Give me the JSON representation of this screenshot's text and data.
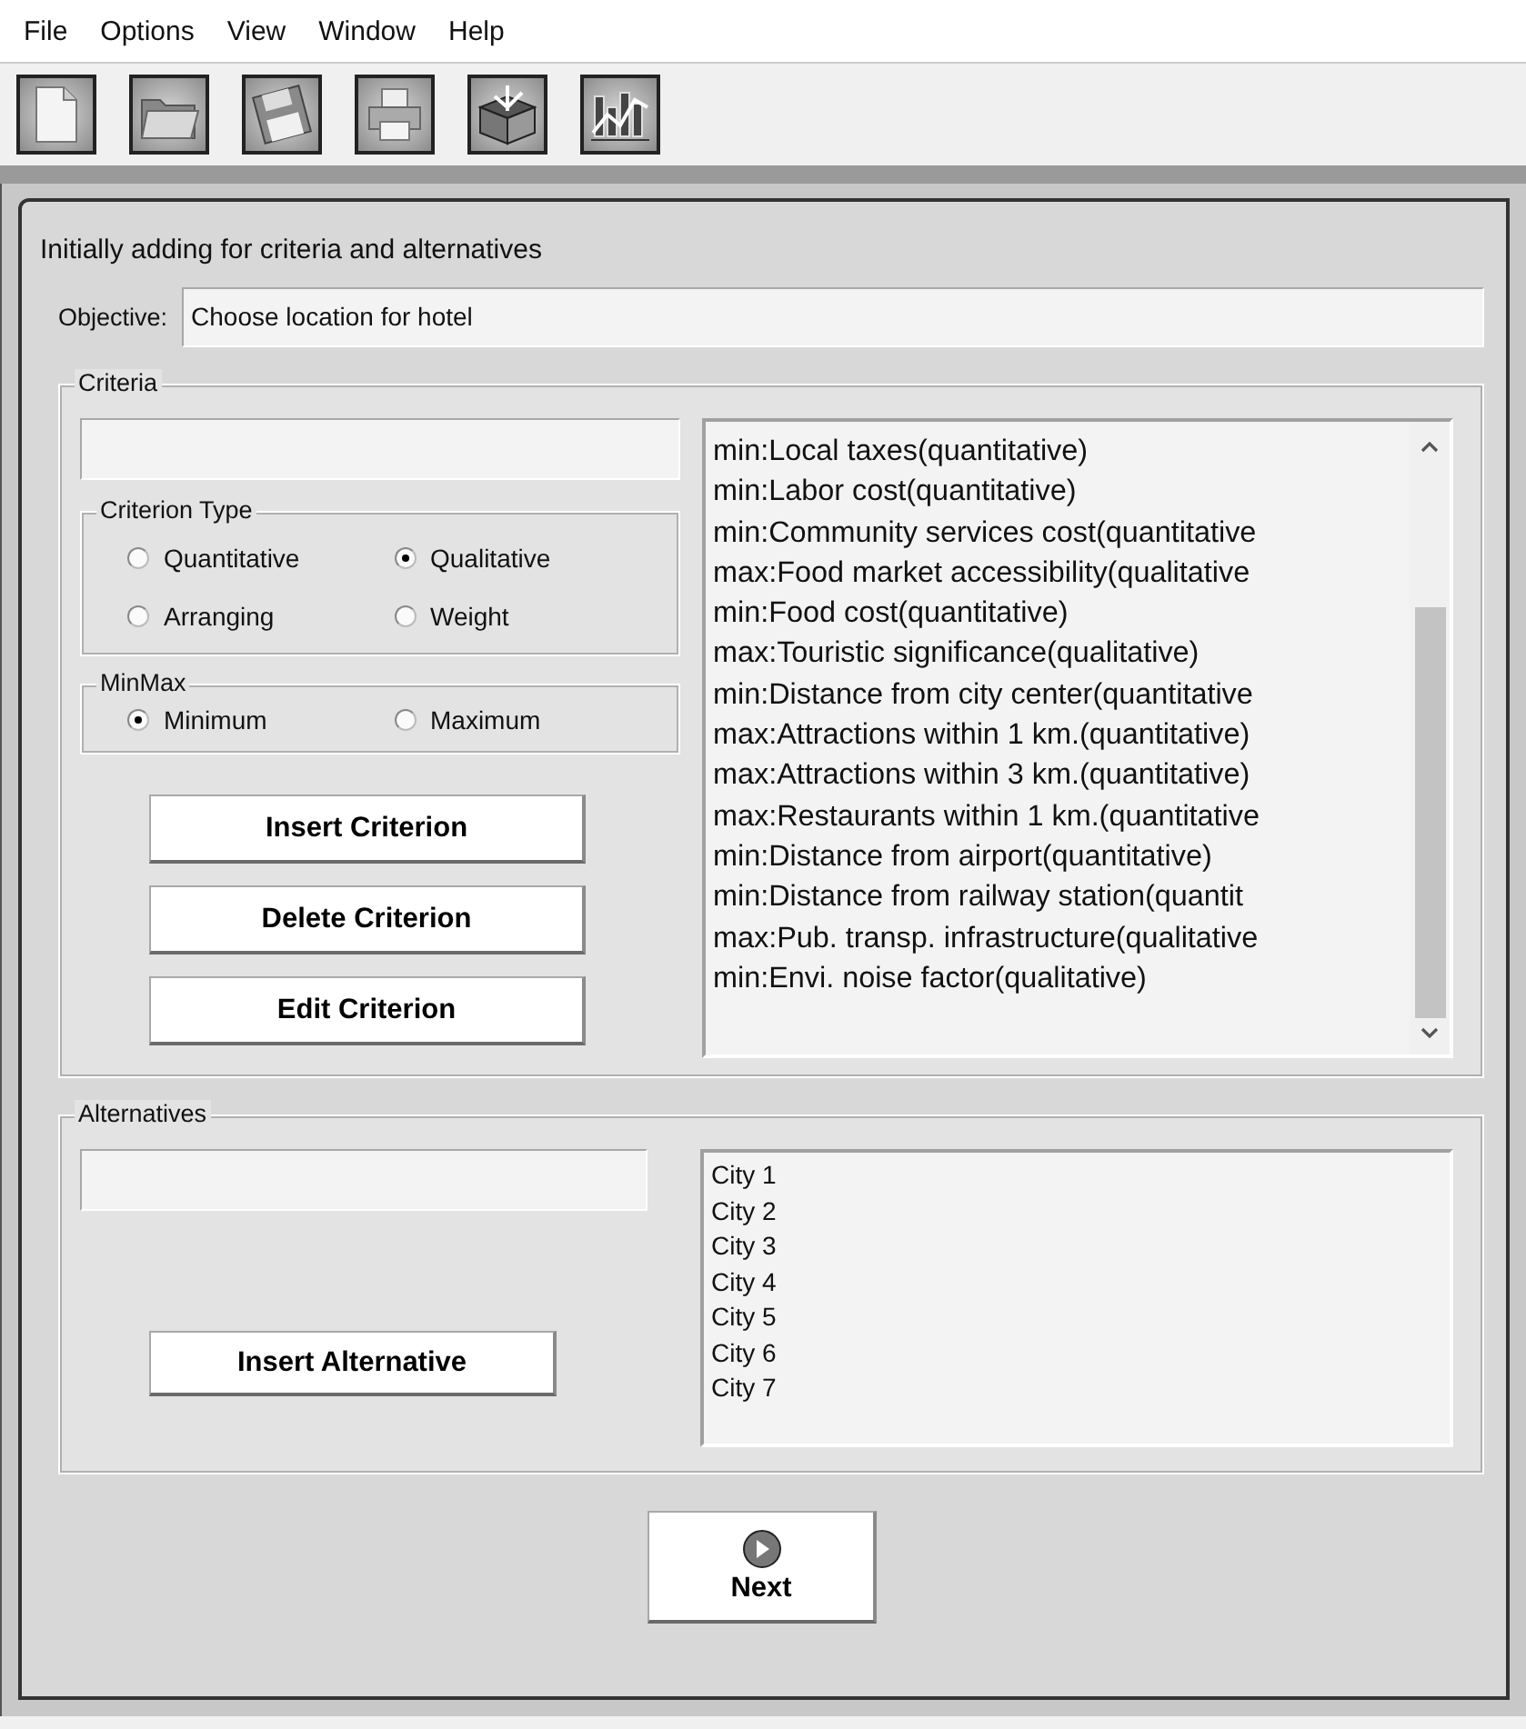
{
  "menu": [
    "File",
    "Options",
    "View",
    "Window",
    "Help"
  ],
  "toolbar": [
    {
      "kind": "new"
    },
    {
      "kind": "open"
    },
    {
      "kind": "save"
    },
    {
      "kind": "print"
    },
    {
      "kind": "tools"
    },
    {
      "kind": "chart"
    }
  ],
  "dialog": {
    "title": "Initially adding for criteria and alternatives",
    "objective": {
      "label": "Objective:",
      "value": "Choose location for hotel"
    },
    "criteria": {
      "legend": "Criteria",
      "criterion_type": {
        "legend": "Criterion Type",
        "options": [
          {
            "label": "Quantitative",
            "selected": false
          },
          {
            "label": "Qualitative",
            "selected": true
          },
          {
            "label": "Arranging",
            "selected": false
          },
          {
            "label": "Weight",
            "selected": false
          }
        ]
      },
      "minmax": {
        "legend": "MinMax",
        "options": [
          {
            "label": "Minimum",
            "selected": true
          },
          {
            "label": "Maximum",
            "selected": false
          }
        ]
      },
      "buttons": [
        "Insert Criterion",
        "Delete Criterion",
        "Edit Criterion"
      ],
      "list": [
        "min:Local taxes(quantitative)",
        "min:Labor cost(quantitative)",
        "min:Community services cost(quantitative",
        "max:Food market accessibility(qualitative",
        "min:Food cost(quantitative)",
        "max:Touristic significance(qualitative)",
        "min:Distance from city center(quantitative",
        "max:Attractions within 1 km.(quantitative)",
        "max:Attractions within 3 km.(quantitative)",
        "max:Restaurants within 1 km.(quantitative",
        "min:Distance from airport(quantitative)",
        "min:Distance from railway station(quantit",
        "max:Pub. transp. infrastructure(qualitative",
        "min:Envi. noise factor(qualitative)"
      ]
    },
    "alternatives": {
      "legend": "Alternatives",
      "button": "Insert Alternative",
      "list": [
        "City 1",
        "City 2",
        "City 3",
        "City 4",
        "City 5",
        "City 6",
        "City 7"
      ]
    },
    "next": "Next"
  }
}
